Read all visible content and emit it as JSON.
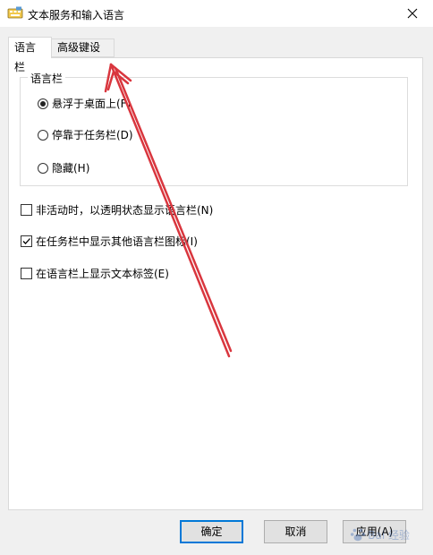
{
  "window": {
    "title": "文本服务和输入语言"
  },
  "tabs": [
    {
      "label": "语言栏",
      "active": true
    },
    {
      "label": "高级键设置",
      "active": false
    }
  ],
  "language_bar_group": {
    "legend": "语言栏",
    "options": [
      {
        "label": "悬浮于桌面上(F)",
        "selected": true
      },
      {
        "label": "停靠于任务栏(D)",
        "selected": false
      },
      {
        "label": "隐藏(H)",
        "selected": false
      }
    ]
  },
  "checkboxes": [
    {
      "label": "非活动时，以透明状态显示语言栏(N)",
      "checked": false
    },
    {
      "label": "在任务栏中显示其他语言栏图标(I)",
      "checked": true
    },
    {
      "label": "在语言栏上显示文本标签(E)",
      "checked": false
    }
  ],
  "buttons": {
    "ok": "确定",
    "cancel": "取消",
    "apply": "应用(A)"
  },
  "annotation": {
    "arrow_color": "#d9363e"
  },
  "watermark": {
    "text": "Bai 经验"
  }
}
